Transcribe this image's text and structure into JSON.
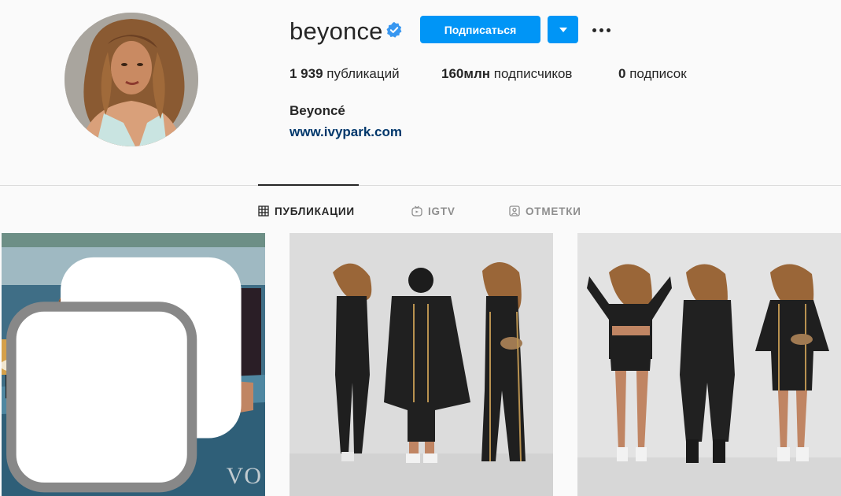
{
  "profile": {
    "username": "beyonce",
    "verified": true,
    "follow_label": "Подписаться",
    "full_name": "Beyoncé",
    "website": "www.ivypark.com",
    "stats": {
      "posts_count": "1 939",
      "posts_label": "публикаций",
      "followers_count": "160млн",
      "followers_label": "подписчиков",
      "following_count": "0",
      "following_label": "подписок"
    }
  },
  "tabs": [
    {
      "label": "ПУБЛИКАЦИИ",
      "icon": "grid-icon",
      "active": true
    },
    {
      "label": "IGTV",
      "icon": "igtv-icon",
      "active": false
    },
    {
      "label": "ОТМЕТКИ",
      "icon": "tagged-icon",
      "active": false
    }
  ],
  "posts": [
    {
      "watermark": "VO",
      "multi_image": true
    },
    {
      "multi_image": false
    },
    {
      "multi_image": false
    }
  ],
  "colors": {
    "accent": "#0095f6",
    "link": "#00376b",
    "text": "#262626",
    "muted": "#8e8e8e",
    "background": "#fafafa",
    "border": "#dbdbdb",
    "verified_badge": "#3897f0"
  }
}
